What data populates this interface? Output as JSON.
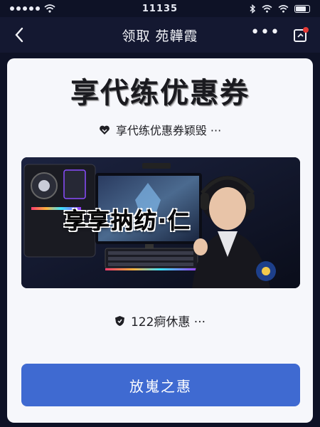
{
  "status_bar": {
    "time": "11135"
  },
  "nav": {
    "title": "领取 苑韡霞",
    "more_label": "•••"
  },
  "card": {
    "headline": "享代练优惠券",
    "subline": "享代练优惠券颖毁 ···",
    "banner": {
      "overlay_text": "享享抐纺·仁"
    },
    "price_row": "122痾休惠 ···",
    "cta_label": "放嵬之惠"
  },
  "colors": {
    "background": "#0e1226",
    "card": "#f6f7fb",
    "cta": "#3f6ad1",
    "notification_dot": "#e53935"
  },
  "icons": {
    "back": "chevron-left-icon",
    "share": "share-icon",
    "subline": "heart-icon",
    "price": "shield-icon"
  }
}
